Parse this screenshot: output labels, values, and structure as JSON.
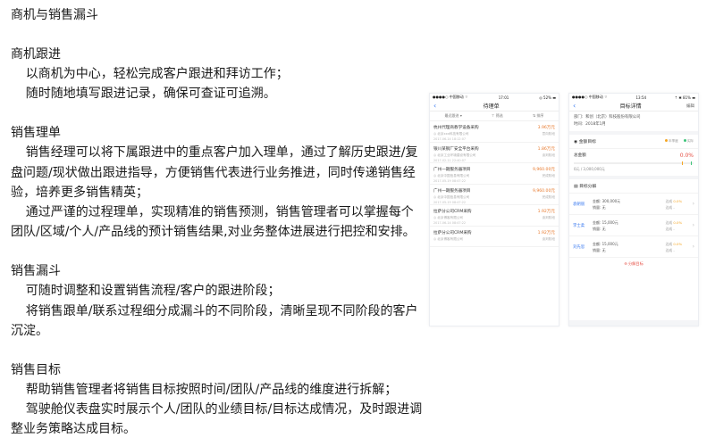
{
  "page": {
    "title": "商机与销售漏斗"
  },
  "sections": [
    {
      "heading": "商机跟进",
      "lines": [
        "以商机为中心，轻松完成客户跟进和拜访工作；",
        "随时随地填写跟进记录，确保可查证可追溯。"
      ]
    },
    {
      "heading": "销售理单",
      "lines": [
        "销售经理可以将下属跟进中的重点客户加入理单，通过了解历史跟进/复盘问题/现状做出跟进指导，方便销售代表进行业务推进，同时传递销售经验，培养更多销售精英；",
        "通过严谨的过程理单，实现精准的销售预测，销售管理者可以掌握每个团队/区域/个人/产品线的预计销售结果,对业务整体进展进行把控和安排。"
      ]
    },
    {
      "heading": "销售漏斗",
      "lines": [
        "可随时调整和设置销售流程/客户的跟进阶段；",
        "将销售跟单/联系过程细分成漏斗的不同阶段，清晰呈现不同阶段的客户沉淀。"
      ]
    },
    {
      "heading": "销售目标",
      "lines": [
        "帮助销售管理者将销售目标按照时间/团队/产品线的维度进行拆解；",
        "驾驶舱仪表盘实时展示个人/团队的业绩目标/目标达成情况，及时跟进调整业务策略达成目标。"
      ]
    }
  ],
  "phone1": {
    "status": {
      "carrier": "●●●●○ 中国移动 ⌔",
      "time": "17:01",
      "battery": "◎ 52% ▬"
    },
    "nav": {
      "back": "‹",
      "title": "待理单"
    },
    "filters": [
      "最近跟进 ▾",
      "⊤ 筛选",
      "⇅ 排序"
    ],
    "items": [
      {
        "name": "杭州代理商教学设备采购",
        "amount": "3.96万元",
        "company": "◎ 北京xxx科技有限公司",
        "stage": "意向阶段",
        "time": "2017-06-14 18:12:07"
      },
      {
        "name": "银川某钢厂安全平台采购",
        "amount": "1.86万元",
        "company": "◎ 北京工业环境建设有限公司",
        "stage": "谈判阶段",
        "time": "2017-02-11 22:40:07"
      },
      {
        "name": "广州一期服务器项目",
        "amount": "9,960.00元",
        "company": "◎ 北京中国信息有限公司",
        "stage": "完成阶段",
        "time": "2017-05-19 08:47:22"
      },
      {
        "name": "广州一期服务器项目",
        "amount": "9,960.00元",
        "company": "◎ 北京中国信息有限公司",
        "stage": "完成阶段",
        "time": "2017-05-19 08:47:22"
      },
      {
        "name": "拉萨分公司CRM采购",
        "amount": "1.92万元",
        "company": "◎ 北京博客有限公司",
        "stage": "谈判阶段",
        "time": "2017-06-14 08:47:22"
      },
      {
        "name": "拉萨分公司CRM采购",
        "amount": "1.92万元",
        "company": "◎ 北京博客有限公司",
        "stage": "谈判阶段",
        "time": ""
      }
    ]
  },
  "phone2": {
    "status": {
      "carrier": "●●●●○ 中国移动 ⌔",
      "time": "13:54",
      "battery": "⇡ ✱ 81% ▬"
    },
    "nav": {
      "back": "‹",
      "title": "目标详情",
      "right": "编辑"
    },
    "info": [
      {
        "label": "部门:",
        "value": "和创（北京）科技股份有限公司"
      },
      {
        "label": "时间:",
        "value": "2018年1月"
      }
    ],
    "goal": {
      "title": "金额目标",
      "legend_a": "年季度",
      "legend_b": "实际",
      "label": "总金额",
      "percent": "0.0%",
      "range": "0元 / 3,000,000元"
    },
    "decomp": {
      "title": "目标分解",
      "rows": [
        {
          "name": "袁朝丽",
          "amount": "金额:  300,000元",
          "sales": "销量:  无",
          "rate_label": "达成",
          "rate": "0.0%",
          "rate2": "达成  -"
        },
        {
          "name": "李士柔",
          "amount": "金额:  15,000元",
          "sales": "销量:  无",
          "rate_label": "达成",
          "rate": "0.0%",
          "rate2": "达成  -"
        },
        {
          "name": "刘先思",
          "amount": "金额:  15,000元",
          "sales": "销量:  无",
          "rate_label": "达成",
          "rate": "0.0%",
          "rate2": "达成  -"
        }
      ],
      "foot": "⊖ 分解目标"
    }
  },
  "colors": {
    "accent": "#3d7cf0",
    "warning": "#f5a623",
    "danger": "#e54d42",
    "success": "#3ec57a"
  }
}
